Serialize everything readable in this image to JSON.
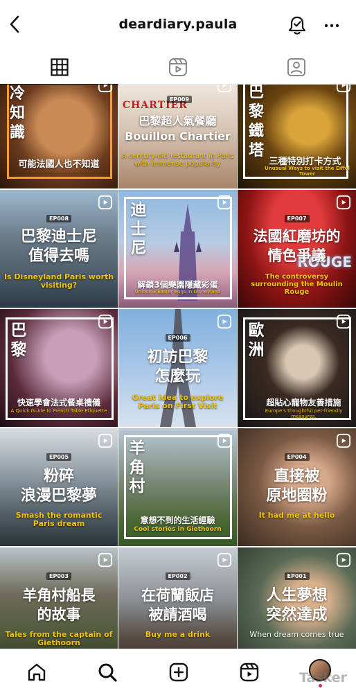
{
  "header": {
    "username": "deardiary.paula"
  },
  "icons": {
    "back": "chevron-left-icon",
    "bell": "notification-bell-icon",
    "more": "more-horizontal-icon",
    "grid": "grid-icon",
    "reels": "reels-icon",
    "tagged": "tagged-person-icon"
  },
  "posts": [
    {
      "vertical": "冷知識",
      "caption": "可能法國人也不知道"
    },
    {
      "ep": "EP009",
      "sign": "CHARTIER",
      "title_lines": [
        "巴黎超人氣餐廳",
        "Bouillon Chartier"
      ],
      "subtitle": "A century-old restaurant in Paris with immense popularity"
    },
    {
      "vertical": "巴黎鐵塔",
      "caption": "三種特別打卡方式",
      "subtitle": "Unusual Ways to visit the Eiffel Tower"
    },
    {
      "ep": "EP008",
      "title_lines": [
        "巴黎迪士尼",
        "值得去嗎"
      ],
      "subtitle": "Is Disneyland Paris worth visiting?"
    },
    {
      "vertical": "迪士尼",
      "caption": "解鎖3個樂園隱藏彩蛋",
      "subtitle": "Unlock 3 Easter eggs in Disneyland"
    },
    {
      "ep": "EP007",
      "title_lines": [
        "法國紅磨坊的",
        "情色爭議"
      ],
      "subtitle": "The controversy surrounding the Moulin Rouge",
      "sign": "ROUGE"
    },
    {
      "vertical": "巴黎",
      "caption": "快速學會法式餐桌禮儀",
      "subtitle": "A Quick Guide to French Table Etiquette"
    },
    {
      "ep": "EP006",
      "title_lines": [
        "初訪巴黎",
        "怎麼玩"
      ],
      "subtitle": "Great idea to explore Paris on First Visit"
    },
    {
      "vertical": "歐洲",
      "caption": "超貼心寵物友善措施",
      "subtitle": "Europe's thoughtful pet-friendly measures."
    },
    {
      "ep": "EP005",
      "title_lines": [
        "粉碎",
        "浪漫巴黎夢"
      ],
      "subtitle": "Smash the romantic Paris dream"
    },
    {
      "vertical": "羊角村",
      "caption": "意想不到的生活經驗",
      "subtitle": "Cool stories in Giethoorn"
    },
    {
      "ep": "EP004",
      "title_lines": [
        "直接被",
        "原地圈粉"
      ],
      "subtitle": "It had me at hello"
    },
    {
      "ep": "EP003",
      "title_lines": [
        "羊角村船長",
        "的故事"
      ],
      "subtitle": "Tales from the captain of Giethoorn"
    },
    {
      "ep": "EP002",
      "title_lines": [
        "在荷蘭飯店",
        "被請酒喝"
      ],
      "subtitle": "Buy me a drink"
    },
    {
      "ep": "EP001",
      "title_lines": [
        "人生夢想",
        "突然達成"
      ],
      "subtitle": "When dream comes true"
    }
  ],
  "bottom_nav": {
    "home": "home-icon",
    "search": "search-icon",
    "create": "create-post-icon",
    "reels": "reels-icon",
    "watermark": "Tasker"
  }
}
